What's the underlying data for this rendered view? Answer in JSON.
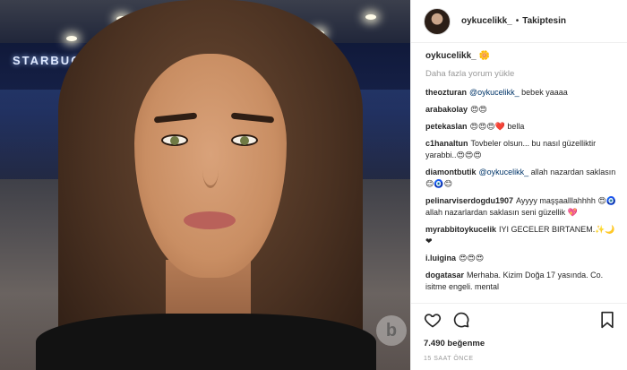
{
  "photo": {
    "sign_left": "STARBUCKS CO",
    "sign_right": "",
    "watermark": "b"
  },
  "header": {
    "username": "oykucelikk_",
    "separator": "•",
    "follow_status": "Takiptesin"
  },
  "caption": {
    "username": "oykucelikk_",
    "text": "🌼"
  },
  "load_more": "Daha fazla yorum yükle",
  "comments": [
    {
      "user": "theozturan",
      "mention": "@oykucelikk_",
      "text": " bebek yaaaa"
    },
    {
      "user": "arabakolay",
      "mention": "",
      "text": "😍😍"
    },
    {
      "user": "petekaslan",
      "mention": "",
      "text": "😍😍😍❤️ bella"
    },
    {
      "user": "c1hanaltun",
      "mention": "",
      "text": "Tovbeler olsun... bu nasıl güzelliktir yarabbi..😍😍😍"
    },
    {
      "user": "diamontbutik",
      "mention": "@oykucelikk_",
      "text": " allah nazardan saklasın 😊🧿😊"
    },
    {
      "user": "pelinarviserdogdu1907",
      "mention": "",
      "text": "Ayyyy maşşaalllahhhh 😍🧿 allah nazarlardan saklasın seni güzellik 💖"
    },
    {
      "user": "myrabbitoykucelik",
      "mention": "",
      "text": "IYI GECELER BIRTANEM.✨🌙❤"
    },
    {
      "user": "i.luigina",
      "mention": "",
      "text": "😍😍😍"
    },
    {
      "user": "dogatasar",
      "mention": "",
      "text": "Merhaba. Kizim Doğa 17 yasında. Co. isitme engeli. mental"
    }
  ],
  "actions": {
    "like_icon": "heart-icon",
    "comment_icon": "comment-icon",
    "save_icon": "bookmark-icon"
  },
  "likes": "7.490 beğenme",
  "time_ago": "15 SAAT ÖNCE"
}
